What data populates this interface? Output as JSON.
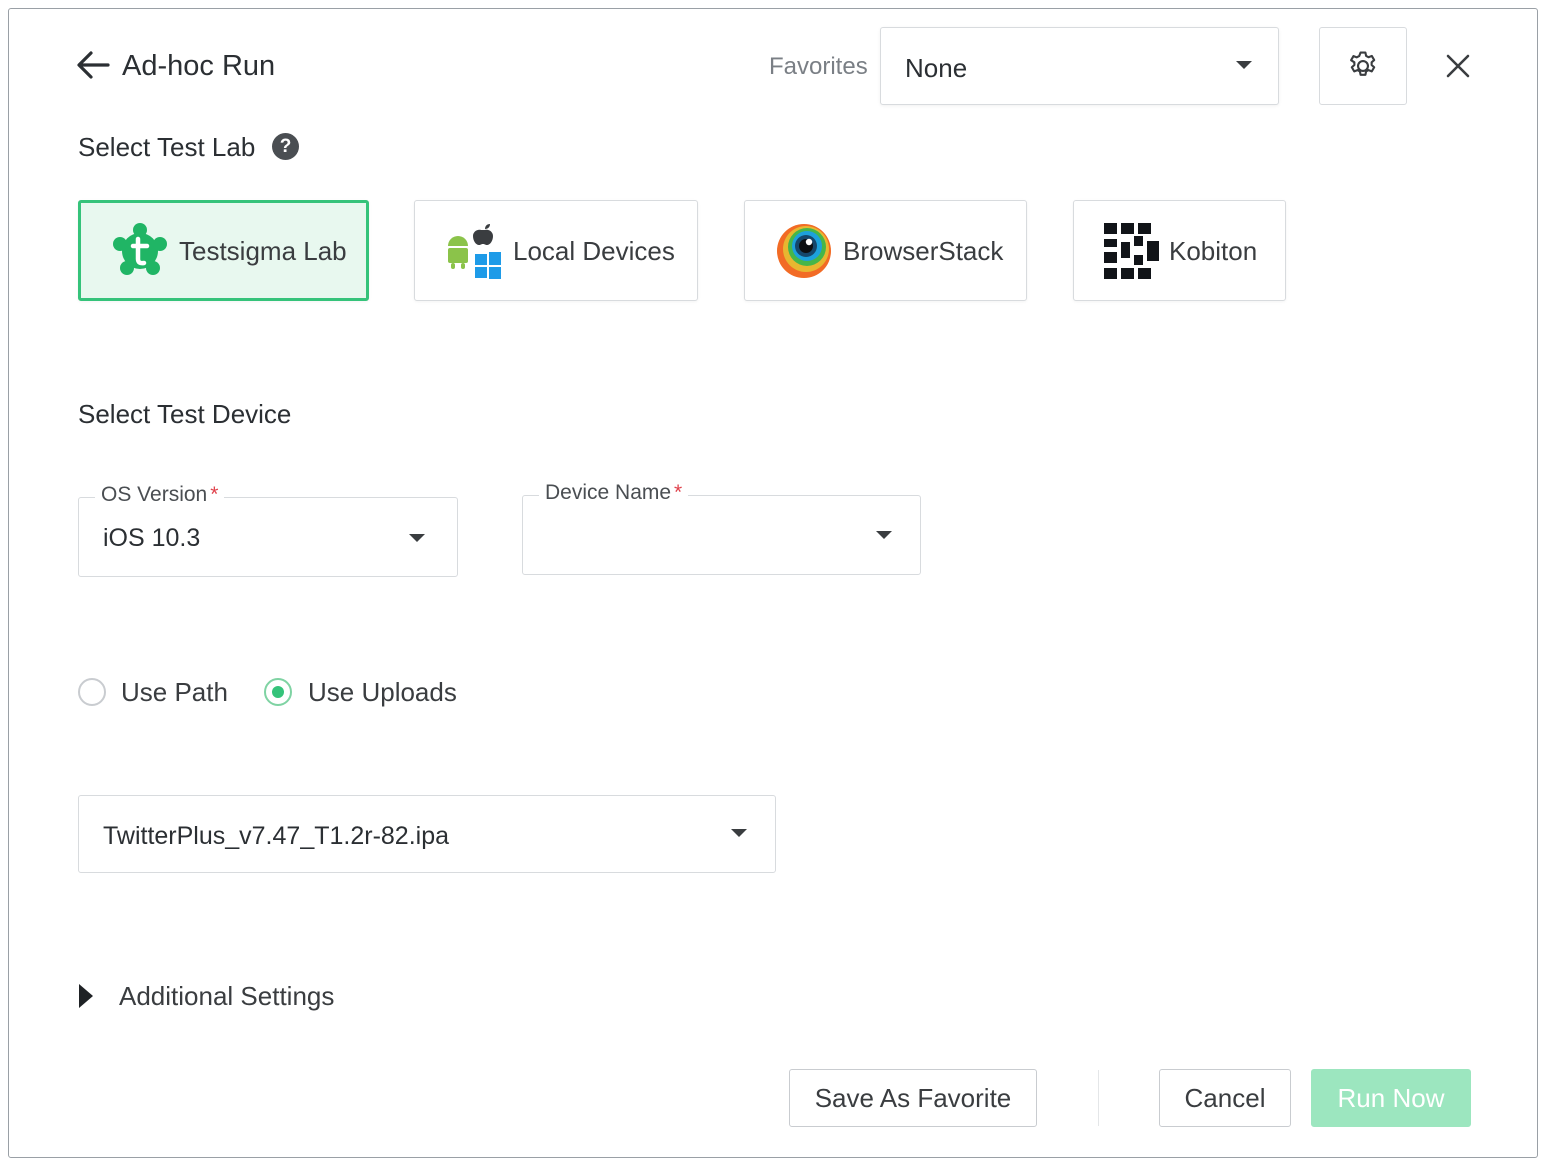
{
  "header": {
    "title": "Ad-hoc Run",
    "favorites_label": "Favorites",
    "favorites_value": "None"
  },
  "icons": {
    "back": "arrow-left-icon",
    "settings": "gear-icon",
    "close": "close-icon",
    "help": "question-circle-icon"
  },
  "test_lab": {
    "title": "Select Test Lab",
    "options": [
      {
        "label": "Testsigma Lab",
        "icon": "testsigma-logo-icon",
        "selected": true
      },
      {
        "label": "Local Devices",
        "icon": "android-apple-windows-icon",
        "selected": false
      },
      {
        "label": "BrowserStack",
        "icon": "browserstack-logo-icon",
        "selected": false
      },
      {
        "label": "Kobiton",
        "icon": "kobiton-logo-icon",
        "selected": false
      }
    ]
  },
  "test_device": {
    "title": "Select Test Device",
    "os_version": {
      "label": "OS Version",
      "required_mark": "*",
      "value": "iOS 10.3"
    },
    "device_name": {
      "label": "Device Name",
      "required_mark": "*",
      "value": ""
    }
  },
  "app_source": {
    "use_path": {
      "label": "Use Path",
      "selected": false
    },
    "use_uploads": {
      "label": "Use Uploads",
      "selected": true
    },
    "upload_value": "TwitterPlus_v7.47_T1.2r-82.ipa"
  },
  "additional_settings": {
    "label": "Additional Settings"
  },
  "footer": {
    "save_favorite": "Save As Favorite",
    "cancel": "Cancel",
    "run_now": "Run Now"
  },
  "colors": {
    "accent": "#35c37a",
    "selected_bg": "#e8f8ef",
    "run_now_disabled": "#9ce6bf",
    "required": "#e0424c"
  }
}
